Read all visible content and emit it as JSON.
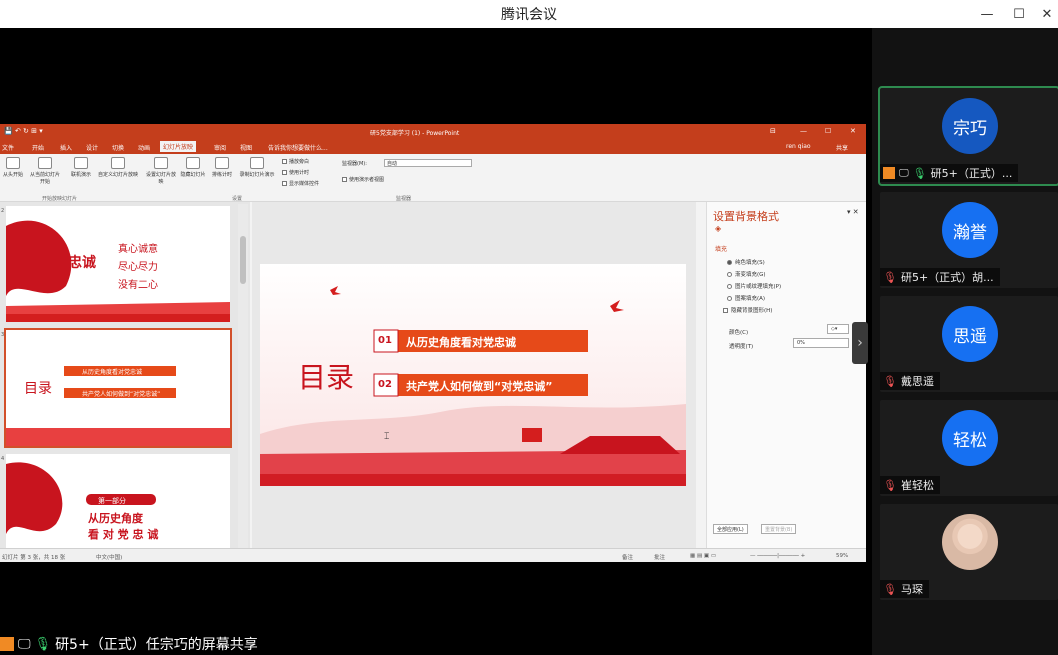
{
  "window": {
    "title": "腾讯会议"
  },
  "participants": [
    {
      "avatar": "宗巧",
      "name": "研5+（正式）...",
      "mic": "on",
      "host": true
    },
    {
      "avatar": "瀚誉",
      "name": "研5+（正式）胡...",
      "mic": "muted"
    },
    {
      "avatar": "思遥",
      "name": "戴思遥",
      "mic": "muted"
    },
    {
      "avatar": "轻松",
      "name": "崔轻松",
      "mic": "muted"
    },
    {
      "avatar": "",
      "name": "马琛",
      "mic": "muted",
      "photo": true
    }
  ],
  "share": {
    "label": "研5+（正式）任宗巧的屏幕共享"
  },
  "ppt": {
    "doc_title": "研5党支部学习 (1) - PowerPoint",
    "user": "ren qiao",
    "share_btn": "共享",
    "search_hint": "告诉我你想要做什么...",
    "tabs": [
      "文件",
      "开始",
      "插入",
      "设计",
      "切换",
      "动画",
      "幻灯片放映",
      "审阅",
      "视图"
    ],
    "selected_tab": "幻灯片放映",
    "ribbon": {
      "buttons": [
        "从头开始",
        "从当前幻灯片开始",
        "联机演示",
        "自定义幻灯片放映",
        "设置幻灯片放映",
        "隐藏幻灯片",
        "排练计时",
        "录制幻灯片演示"
      ],
      "checks": [
        "播放旁白",
        "使用计时",
        "显示媒体控件"
      ],
      "monitor_label": "监视器(M):",
      "monitor_value": "自动",
      "presenter_view": "使用演示者视图",
      "groups": [
        "开始放映幻灯片",
        "设置",
        "监视器"
      ]
    },
    "thumbs": [
      {
        "num": "2",
        "lines": [
          "忠诚",
          "真心诚意",
          "尽心尽力",
          "没有二心"
        ]
      },
      {
        "num": "3",
        "lines": [
          "目录",
          "从历史角度看对党忠诚",
          "共产党人如何做到“对党忠诚”"
        ]
      },
      {
        "num": "4",
        "lines": [
          "第一部分",
          "从历史角度",
          "看 对 党 忠 诚"
        ]
      }
    ],
    "slide": {
      "title": "目录",
      "items": [
        {
          "num": "01",
          "text": "从历史角度看对党忠诚"
        },
        {
          "num": "02",
          "text": "共产党人如何做到“对党忠诚”"
        }
      ]
    },
    "pane": {
      "title": "设置背景格式",
      "section": "填充",
      "options": [
        "纯色填充(S)",
        "渐变填充(G)",
        "图片或纹理填充(P)",
        "图案填充(A)"
      ],
      "hide_bg": "隐藏背景图形(H)",
      "color_label": "颜色(C)",
      "transparency_label": "透明度(T)",
      "transparency_value": "0%",
      "apply_all": "全部应用(L)",
      "reset": "重置背景(B)"
    },
    "status": {
      "slide_info": "幻灯片 第 3 张，共 18 张",
      "lang": "中文(中国)",
      "notes": "备注",
      "comments": "批注",
      "zoom": "59%"
    }
  },
  "colors": {
    "accent": "#c43e1c",
    "avatar": "#1670f2",
    "mic_on": "#3bd16f"
  }
}
